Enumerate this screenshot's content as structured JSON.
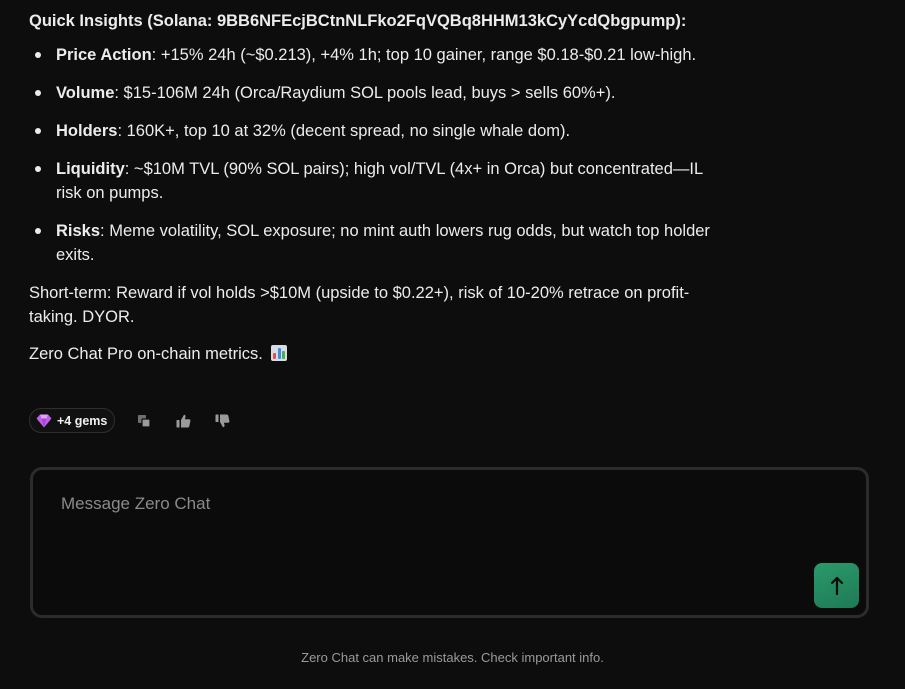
{
  "message": {
    "heading": "Quick Insights (Solana: 9BB6NFEcjBCtnNLFko2FqVQBq8HHM13kCyYcdQbgpump):",
    "bullets": [
      {
        "label": "Price Action",
        "sep": ":",
        "text": " +15% 24h (~$0.213), +4% 1h; top 10 gainer, range $0.18-$0.21 low-high."
      },
      {
        "label": "Volume",
        "sep": ":",
        "text": " $15-106M 24h (Orca/Raydium SOL pools lead, buys > sells 60%+)."
      },
      {
        "label": "Holders",
        "sep": ":",
        "text": " 160K+, top 10 at 32% (decent spread, no single whale dom)."
      },
      {
        "label": "Liquidity",
        "sep": ":",
        "text": " ~$10M TVL (90% SOL pairs); high vol/TVL (4x+ in Orca) but concentrated—IL risk on pumps."
      },
      {
        "label": "Risks",
        "sep": ":",
        "text": " Meme volatility, SOL exposure; no mint auth lowers rug odds, but watch top holder exits."
      }
    ],
    "short_term": "Short-term: Reward if vol holds >$10M (upside to $0.22+), risk of 10-20% retrace on profit-taking. DYOR.",
    "footer_line": "Zero Chat Pro on-chain metrics.",
    "footer_emoji": "bar-chart-emoji"
  },
  "actions": {
    "gems_label": "+4 gems",
    "gem_icon": "gem-icon",
    "icons": [
      "copy-icon",
      "thumbs-up-icon",
      "thumbs-down-icon"
    ]
  },
  "composer": {
    "placeholder": "Message Zero Chat",
    "value": "",
    "send_icon": "arrow-up-icon"
  },
  "disclaimer": "Zero Chat can make mistakes. Check important info.",
  "colors": {
    "background": "#0d0d0d",
    "text": "#ececec",
    "send_button": "#23875f",
    "gem": "#c060e8"
  }
}
